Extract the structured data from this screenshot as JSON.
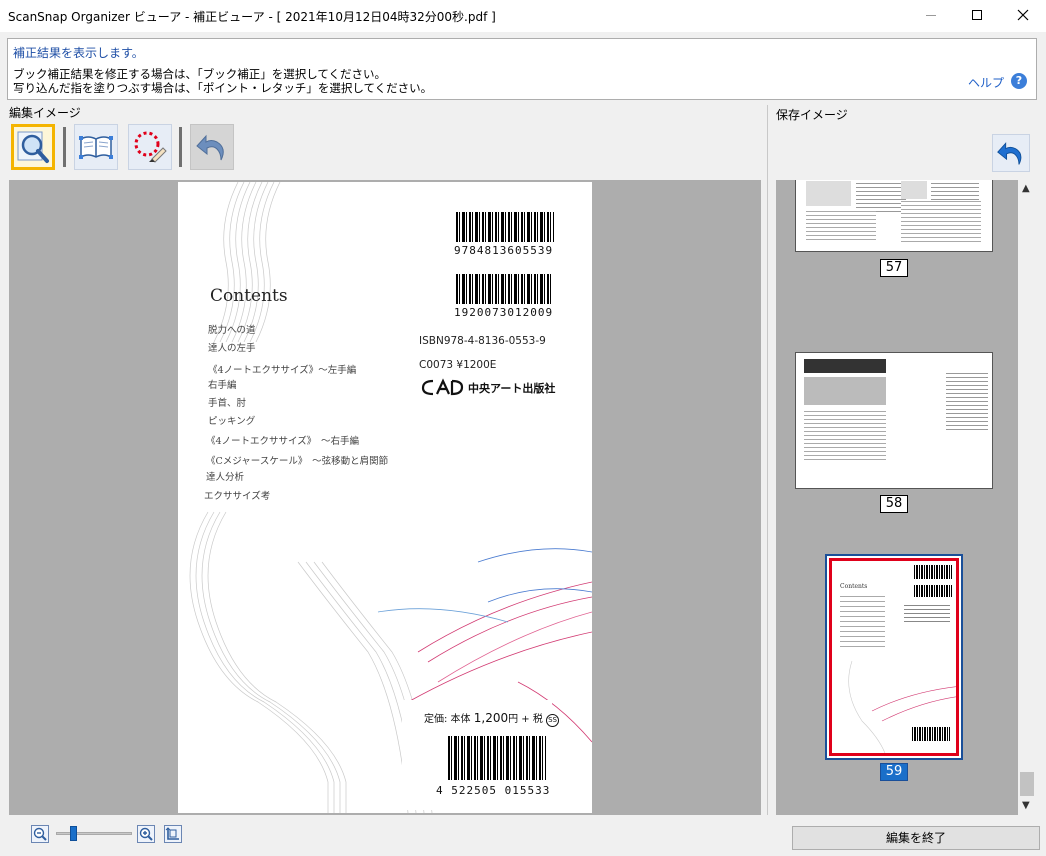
{
  "window": {
    "title": "ScanSnap Organizer ビューア - 補正ビューア - [ 2021年10月12日04時32分00秒.pdf ]"
  },
  "info": {
    "line1": "補正結果を表示します。",
    "line2": "ブック補正結果を修正する場合は、「ブック補正」を選択してください。",
    "line3": "写り込んだ指を塗りつぶす場合は、「ポイント・レタッチ」を選択してください。",
    "help": "ヘルプ"
  },
  "labels": {
    "edit_image": "編集イメージ",
    "saved_image": "保存イメージ"
  },
  "toolbar": {
    "icons": [
      "magnifier-icon",
      "book-correction-icon",
      "point-retouch-icon",
      "undo-icon"
    ]
  },
  "page_content": {
    "contents_title": "Contents",
    "toc": [
      "脱力への道",
      "達人の左手",
      "《4ノートエクササイズ》〜左手編",
      "右手編",
      "手首、肘",
      "ピッキング",
      "《4ノートエクササイズ》　〜右手編",
      "《Cメジャースケール》　〜弦移動と肩関節",
      "達人分析",
      "エクササイズ考"
    ],
    "isbn_barcode_number": "9784813605539",
    "code_barcode_number": "1920073012009",
    "isbn": "ISBN978-4-8136-0553-9",
    "code_price": "C0073 ¥1200E",
    "publisher": "中央アート出版社",
    "price_prefix": "定価: 本体",
    "price_amount": "1,200",
    "price_suffix": "円 + 税",
    "bottom_barcode_number": "4 522505 015533"
  },
  "thumbnails": [
    {
      "number": "57",
      "selected": false
    },
    {
      "number": "58",
      "selected": false
    },
    {
      "number": "59",
      "selected": true
    }
  ],
  "footer": {
    "end_edit": "編集を終了"
  },
  "colors": {
    "accent": "#1a6fc9",
    "active_tool_border": "#f4b400",
    "selected_thumb_border": "#e0001a"
  }
}
